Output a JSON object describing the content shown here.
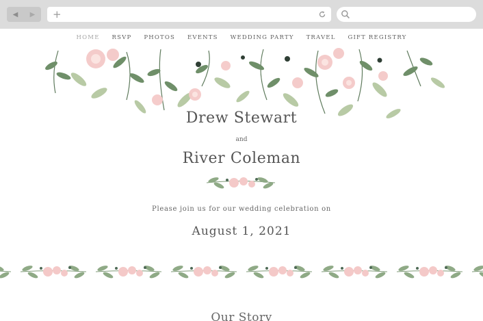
{
  "browser": {
    "back_icon": "triangle-left",
    "forward_icon": "triangle-right",
    "new_tab_icon": "plus",
    "reload_icon": "circular-arrow",
    "search_icon": "magnifier"
  },
  "nav": {
    "items": [
      "HOME",
      "RSVP",
      "PHOTOS",
      "EVENTS",
      "WEDDING PARTY",
      "TRAVEL",
      "GIFT REGISTRY"
    ],
    "active": "HOME"
  },
  "couple": {
    "name1": "Drew Stewart",
    "and": "and",
    "name2": "River Coleman"
  },
  "invite_text": "Please join us for our wedding celebration on",
  "date": "August 1, 2021",
  "next_section_title": "Our Story",
  "colors": {
    "chrome": "#dcdcdc",
    "text": "#555555",
    "active_nav": "#a6a6a6",
    "leaf_dark": "#5e7a5c",
    "leaf_light": "#b8caa5",
    "blossom": "#f4c9c8"
  }
}
